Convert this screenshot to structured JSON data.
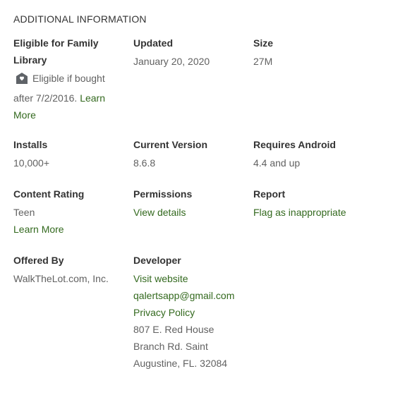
{
  "section_title": "ADDITIONAL INFORMATION",
  "family_library": {
    "label": "Eligible for Family Library",
    "icon": "family-library-icon",
    "text": "Eligible if bought after 7/2/2016.",
    "link": "Learn More"
  },
  "updated": {
    "label": "Updated",
    "value": "January 20, 2020"
  },
  "size": {
    "label": "Size",
    "value": "27M"
  },
  "installs": {
    "label": "Installs",
    "value": "10,000+"
  },
  "current_version": {
    "label": "Current Version",
    "value": "8.6.8"
  },
  "requires_android": {
    "label": "Requires Android",
    "value": "4.4 and up"
  },
  "content_rating": {
    "label": "Content Rating",
    "value": "Teen",
    "link": "Learn More"
  },
  "permissions": {
    "label": "Permissions",
    "link": "View details"
  },
  "report": {
    "label": "Report",
    "link": "Flag as inappropriate"
  },
  "offered_by": {
    "label": "Offered By",
    "value": "WalkTheLot.com, Inc."
  },
  "developer": {
    "label": "Developer",
    "website_link": "Visit website",
    "email_link": "qalertsapp@gmail.com",
    "privacy_link": "Privacy Policy",
    "address": "807 E. Red House Branch Rd. Saint Augustine, FL. 32084"
  },
  "colors": {
    "link": "#33691e",
    "label": "#333333",
    "value": "#616161"
  }
}
